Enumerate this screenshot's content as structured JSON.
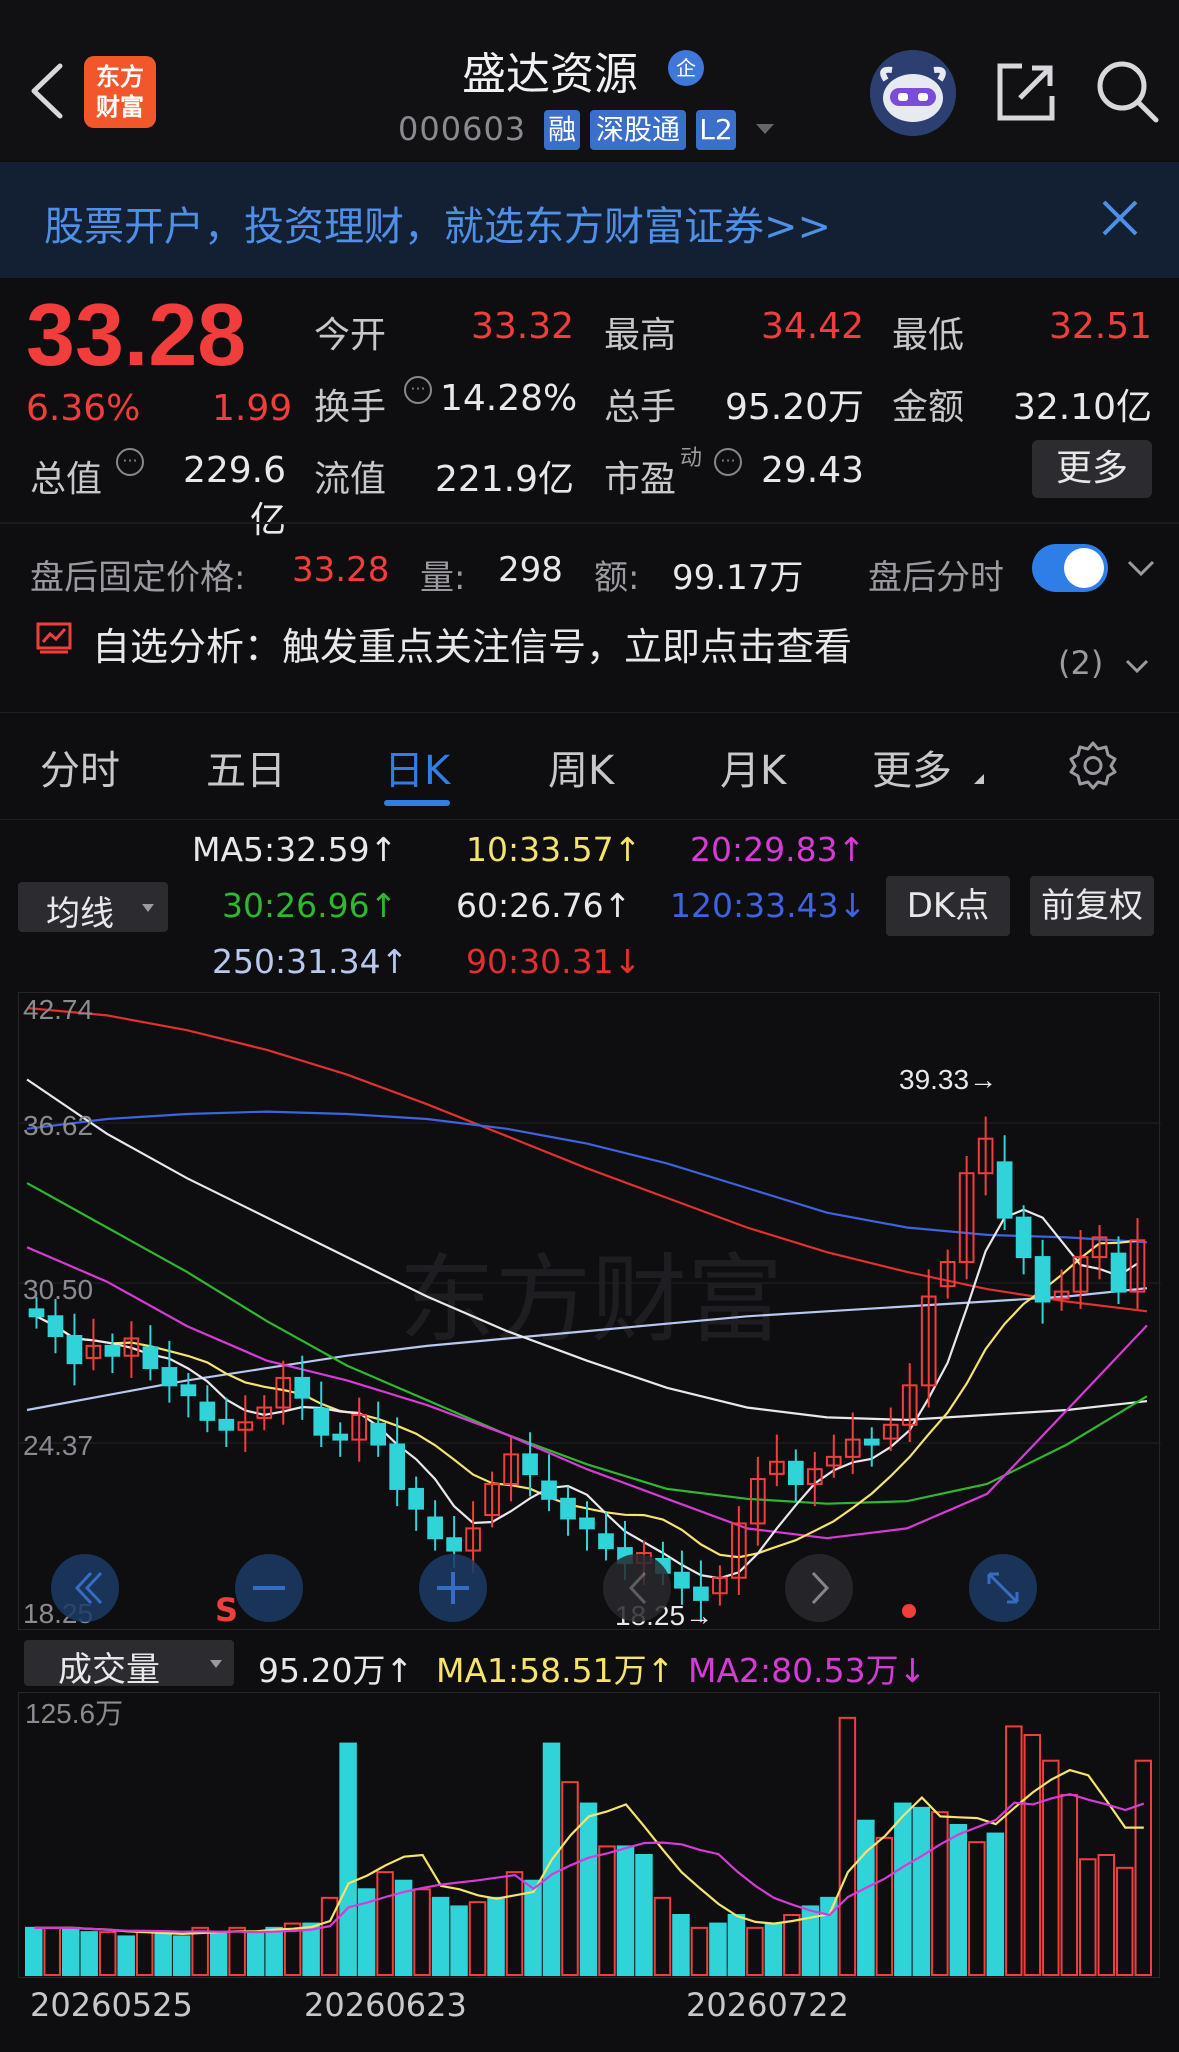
{
  "header": {
    "stock_name": "盛达资源",
    "qi_badge": "企",
    "stock_code": "000603",
    "tags": [
      "融",
      "深股通",
      "L2"
    ],
    "logo_text": [
      "东方",
      "财富"
    ]
  },
  "banner": {
    "text": "股票开户，投资理财，就选东方财富证券>>"
  },
  "quote": {
    "price": "33.28",
    "change_pct": "6.36%",
    "change_amt": "1.99",
    "open_label": "今开",
    "open": "33.32",
    "high_label": "最高",
    "high": "34.42",
    "low_label": "最低",
    "low": "32.51",
    "turnover_label": "换手",
    "turnover": "14.28%",
    "volume_label": "总手",
    "volume": "95.20万",
    "amount_label": "金额",
    "amount": "32.10亿",
    "mktcap_label": "总值",
    "mktcap": "229.6亿",
    "float_label": "流值",
    "float": "221.9亿",
    "pe_label": "市盈",
    "pe_sup": "动",
    "pe": "29.43",
    "more_label": "更多"
  },
  "after_hours": {
    "label": "盘后固定价格:",
    "price": "33.28",
    "vol_label": "量:",
    "vol": "298",
    "amt_label": "额:",
    "amt": "99.17万",
    "toggle_label": "盘后分时",
    "toggle_on": true
  },
  "analysis": {
    "text": "自选分析：触发重点关注信号，立即点击查看",
    "count": "(2)"
  },
  "tabs": [
    {
      "label": "分时"
    },
    {
      "label": "五日"
    },
    {
      "label": "日K",
      "active": true
    },
    {
      "label": "周K"
    },
    {
      "label": "月K"
    },
    {
      "label": "更多"
    }
  ],
  "ma_panel": {
    "selector": "均线",
    "ma5": "MA5:32.59↑",
    "ma10": "10:33.57↑",
    "ma20": "20:29.83↑",
    "ma30": "30:26.96↑",
    "ma60": "60:26.76↑",
    "ma120": "120:33.43↓",
    "ma250": "250:31.34↑",
    "ma90": "90:30.31↓",
    "dk_button": "DK点",
    "adjust_button": "前复权",
    "colors": {
      "ma5": "#e8e8ea",
      "ma10": "#f5e36b",
      "ma20": "#d63bd6",
      "ma30": "#2fb82f",
      "ma60": "#e8e8ea",
      "ma120": "#3f62e0",
      "ma250": "#b8c8f0",
      "ma90": "#e03030"
    }
  },
  "kline": {
    "y_labels": [
      "42.74",
      "36.62",
      "30.50",
      "24.37",
      "18.25"
    ],
    "high_marker": "39.33→",
    "low_marker": "18.25→",
    "s_marker": "S",
    "watermark": "东方财富"
  },
  "volume_panel": {
    "selector": "成交量",
    "value": "95.20万↑",
    "ma1": "MA1:58.51万↑",
    "ma2": "MA2:80.53万↓",
    "y_label": "125.6万",
    "dates": [
      "20260525",
      "20260623",
      "20260722"
    ]
  }
}
